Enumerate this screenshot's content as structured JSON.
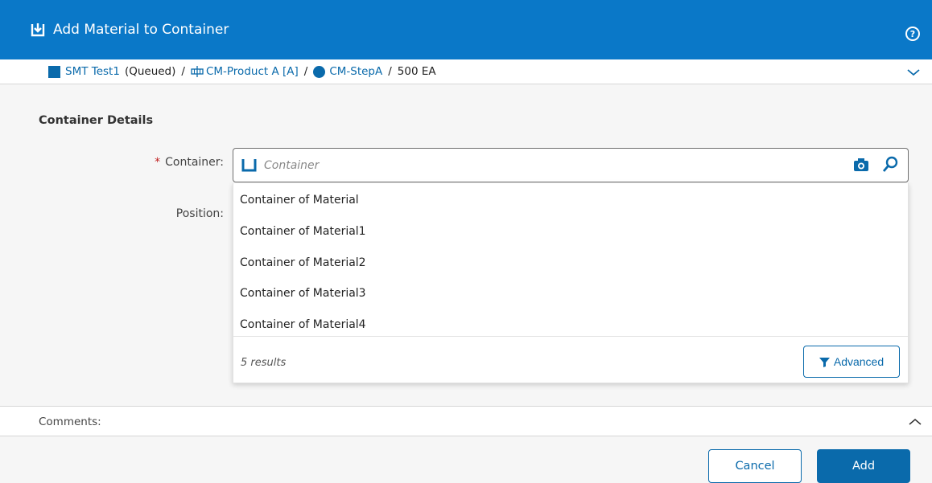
{
  "window": {
    "title": "Add Material to Container",
    "title_icon": "download-into-tray-icon",
    "help_icon": "help-circle-icon",
    "help_glyph": "?"
  },
  "breadcrumb": {
    "material_icon": "material-square-icon",
    "material": "SMT Test1",
    "status": "(Queued)",
    "product_icon": "product-structure-icon",
    "product": "CM-Product A [A]",
    "step_icon": "step-circle-icon",
    "step": "CM-StepA",
    "quantity": "500 EA",
    "separator": "/",
    "expand_icon": "chevron-down-icon"
  },
  "form": {
    "section_title": "Container Details",
    "container_label": "Container:",
    "required_marker": "*",
    "container_placeholder": "Container",
    "container_value": "",
    "position_label": "Position:"
  },
  "dropdown": {
    "items": [
      "Container of Material",
      "Container of Material1",
      "Container of Material2",
      "Container of Material3",
      "Container of Material4"
    ],
    "results_text": "5 results",
    "advanced_label": "Advanced"
  },
  "comments": {
    "label": "Comments:",
    "toggle_icon": "chevron-up-icon"
  },
  "footer": {
    "cancel_label": "Cancel",
    "add_label": "Add"
  },
  "colors": {
    "titlebar": "#0a78c8",
    "accent": "#0a6aab",
    "required": "#c02020",
    "panel": "#f6f6f6"
  }
}
